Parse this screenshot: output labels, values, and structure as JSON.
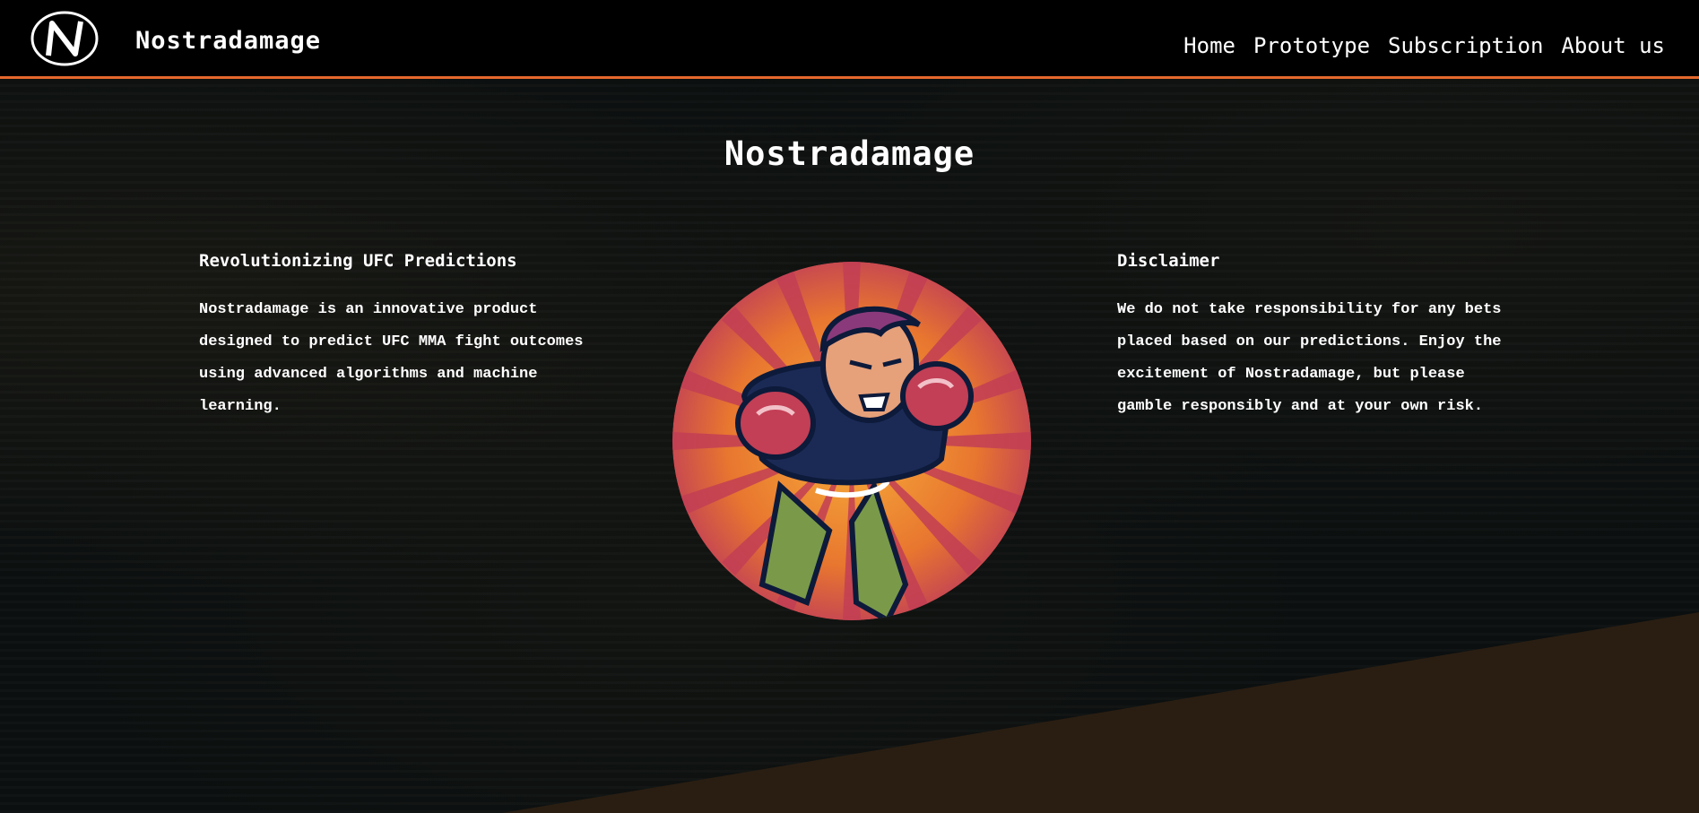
{
  "header": {
    "brand": "Nostradamage",
    "logo_icon": "n-monogram-logo",
    "nav": [
      "Home",
      "Prototype",
      "Subscription",
      "About us"
    ],
    "accent_color": "#e4672c"
  },
  "main": {
    "title": "Nostradamage",
    "left": {
      "heading": "Revolutionizing UFC Predictions",
      "body": "Nostradamage is an innovative product designed to predict UFC MMA fight outcomes using advanced algorithms and machine learning."
    },
    "right": {
      "heading": "Disclaimer",
      "body": "We do not take responsibility for any bets placed based on our predictions. Enjoy the excitement of Nostradamage, but please gamble responsibly and at your own risk."
    },
    "hero_image": "fighter-illustration"
  }
}
